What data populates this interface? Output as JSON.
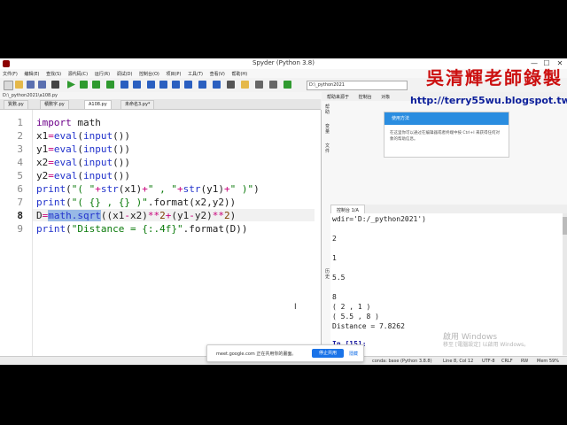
{
  "window": {
    "title": "Spyder (Python 3.8)",
    "minimize": "—",
    "maximize": "☐",
    "close": "✕"
  },
  "menu": [
    "文件(F)",
    "编辑(E)",
    "查找(S)",
    "源代码(C)",
    "运行(R)",
    "调试(D)",
    "控制台(O)",
    "项目(P)",
    "工具(T)",
    "查看(V)",
    "帮助(H)"
  ],
  "toolbar": {
    "path_value": "D:\\_python2021"
  },
  "editor_path": "D:\\_python2021\\a108.py",
  "tabs": [
    "質數.py",
    "積數字.py",
    "A108.py",
    "未命名3.py*"
  ],
  "active_tab_index": 2,
  "code": {
    "line_numbers": [
      "1",
      "2",
      "3",
      "4",
      "5",
      "6",
      "7",
      "8",
      "9"
    ],
    "current_line": "8",
    "lines": [
      "import math",
      "x1=eval(input())",
      "y1=eval(input())",
      "x2=eval(input())",
      "y2=eval(input())",
      "print(\"( \"+str(x1)+\" , \"+str(y1)+\" )\")",
      "print(\"( {} , {} )\".format(x2,y2))",
      "D=math.sqrt((x1-x2)**2+(y1-y2)**2)",
      "print(\"Distance = {:.4f}\".format(D))"
    ]
  },
  "help_pane": {
    "tabs": [
      "帮助来源于",
      "控制台",
      "对象"
    ],
    "signature_url": "http://terry55wu.blogspot.tw",
    "signature_name": "吳清輝老師錄製",
    "card_title": "使用方法",
    "card_body": "在这里你可以通过在编辑器或者终端中按 Ctrl+I 来获得任何对象的帮助信息。"
  },
  "side_labels": [
    "帮助",
    "变量",
    "文件",
    "历史"
  ],
  "console_tab": "控制台 1/A",
  "console": {
    "lines": [
      "wdir='D:/_python2021')",
      "",
      "2",
      "",
      "1",
      "",
      "5.5",
      "",
      "8",
      "( 2 , 1 )",
      "( 5.5 , 8 )",
      "Distance = 7.8262",
      ""
    ],
    "prompt": "In [15]:"
  },
  "watermark": {
    "title": "啟用 Windows",
    "subtitle": "移至 [電腦設定] 以啟用 Windows。"
  },
  "status": {
    "conda": "conda: base (Python 3.8.8)",
    "position": "Line 8, Col 12",
    "encoding": "UTF-8",
    "eol": "CRLF",
    "rw": "RW",
    "mem": "Mem 59%"
  },
  "share_bar": {
    "text": "meet.google.com 正在共用你的畫面。",
    "stop": "停止共用",
    "hide": "隱藏"
  }
}
